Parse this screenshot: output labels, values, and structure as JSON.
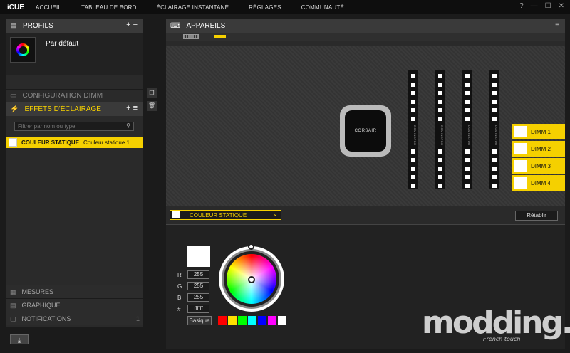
{
  "app": {
    "name": "iCUE"
  },
  "nav": [
    "ACCUEIL",
    "TABLEAU DE BORD",
    "ÉCLAIRAGE INSTANTANÉ",
    "RÉGLAGES",
    "COMMUNAUTÉ"
  ],
  "window_controls": [
    "?",
    "—",
    "☐",
    "✕"
  ],
  "profiles": {
    "title": "PROFILS",
    "active": "Par défaut",
    "add": "+",
    "menu": "≡"
  },
  "sections": {
    "dimm_config": "CONFIGURATION DIMM",
    "effects": "EFFETS D'ÉCLAIRAGE",
    "measures": "MESURES",
    "graph": "GRAPHIQUE",
    "notifications": "NOTIFICATIONS",
    "notif_count": "1"
  },
  "effects": {
    "search_placeholder": "Filtrer par nom ou type",
    "item_type": "COULEUR STATIQUE",
    "item_name": "Couleur statique 1"
  },
  "devices": {
    "title": "APPAREILS",
    "dimms": [
      "DIMM 1",
      "DIMM 2",
      "DIMM 3",
      "DIMM 4"
    ],
    "pump_brand": "CORSAIR",
    "dimm_brand": "DOMINATOR"
  },
  "effect_bar": {
    "selected": "COULEUR STATIQUE",
    "reset": "Rétablir"
  },
  "color": {
    "labels": [
      "R",
      "G",
      "B",
      "#"
    ],
    "values": [
      "255",
      "255",
      "255",
      "ffffff"
    ],
    "basic": "Basique",
    "swatches": [
      "#ff0000",
      "#ffe000",
      "#00ff00",
      "#00ffff",
      "#0000ff",
      "#ff00ff",
      "#ffffff"
    ]
  },
  "watermark": {
    "text": "modding.fr",
    "sub": "French touch"
  }
}
